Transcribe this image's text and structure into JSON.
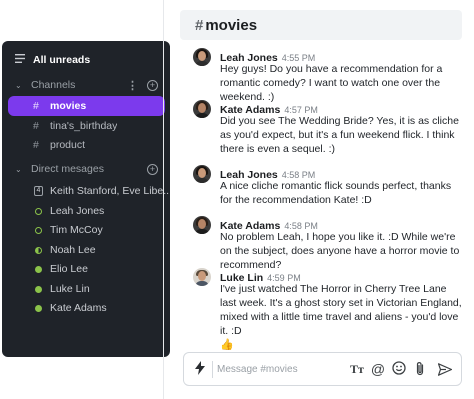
{
  "sidebar": {
    "all_unreads": "All unreads",
    "channels_header": "Channels",
    "channels": [
      {
        "name": "movies",
        "active": true
      },
      {
        "name": "tina's_birthday",
        "active": false
      },
      {
        "name": "product",
        "active": false
      }
    ],
    "dm_header": "Direct mesages",
    "direct_messages": [
      {
        "name": "Keith Stanford, Eve Libe...",
        "presence": "group",
        "count": "4"
      },
      {
        "name": "Leah Jones",
        "presence": "away"
      },
      {
        "name": "Tim McCoy",
        "presence": "away"
      },
      {
        "name": "Noah Lee",
        "presence": "half"
      },
      {
        "name": "Elio Lee",
        "presence": "online"
      },
      {
        "name": "Luke Lin",
        "presence": "online"
      },
      {
        "name": "Kate Adams",
        "presence": "online"
      }
    ]
  },
  "channel": {
    "hash": "#",
    "name": "movies"
  },
  "messages": [
    {
      "author": "Leah Jones",
      "time": "4:55 PM",
      "text": "Hey guys! Do you have a recommendation for a romantic comedy? I want to watch one over the weekend. :)"
    },
    {
      "author": "Kate Adams",
      "time": "4:57 PM",
      "text": "Did you see The Wedding Bride? Yes, it is as cliche as you'd expect, but it's a fun weekend flick. I think there is even a sequel. :)"
    },
    {
      "author": "Leah Jones",
      "time": "4:58 PM",
      "text": "A nice cliche romantic flick sounds perfect, thanks for the recommendation Kate! :D"
    },
    {
      "author": "Kate Adams",
      "time": "4:58 PM",
      "text": "No problem Leah, I hope you like it. :D While we're on the subject, does anyone have a horror movie to recommend?"
    },
    {
      "author": "Luke Lin",
      "time": "4:59 PM",
      "text": "I've just watched The Horror in Cherry Tree Lane last week. It's a ghost story set in Victorian England, mixed with a little time travel and aliens - you'd love it. :D",
      "reaction": "👍"
    }
  ],
  "composer": {
    "placeholder": "Message #movies",
    "format_label": "Tт",
    "mention_label": "@"
  },
  "colors": {
    "accent": "#7c3aed",
    "sidebar_bg": "#1f2329",
    "presence": "#8bc34a"
  }
}
